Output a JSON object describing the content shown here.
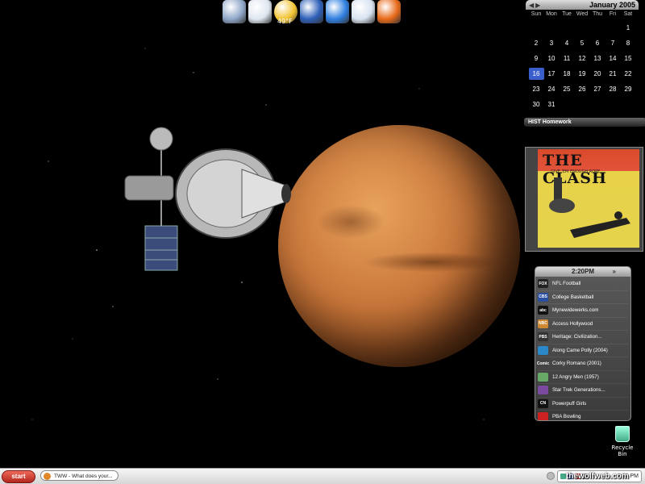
{
  "dock": {
    "items": [
      {
        "icon": "mail-icon",
        "color": "#8fa7c9"
      },
      {
        "icon": "clock-icon",
        "color": "#dfe6f0"
      },
      {
        "icon": "weather-icon",
        "color": "#f2c230",
        "label": "49°F"
      },
      {
        "icon": "app-launcher-icon",
        "color": "#2d5fb8"
      },
      {
        "icon": "gear-icon",
        "color": "#2f7fe0"
      },
      {
        "icon": "media-icon",
        "color": "#d8e3f0"
      },
      {
        "icon": "firefox-icon",
        "color": "#e86a1a"
      }
    ]
  },
  "calendar": {
    "month": "January 2005",
    "weekdays": [
      "Sun",
      "Mon",
      "Tue",
      "Wed",
      "Thu",
      "Fri",
      "Sat"
    ],
    "weeks": [
      [
        "",
        "",
        "",
        "",
        "",
        "",
        "1"
      ],
      [
        "2",
        "3",
        "4",
        "5",
        "6",
        "7",
        "8"
      ],
      [
        "9",
        "10",
        "11",
        "12",
        "13",
        "14",
        "15"
      ],
      [
        "16",
        "17",
        "18",
        "19",
        "20",
        "21",
        "22"
      ],
      [
        "23",
        "24",
        "25",
        "26",
        "27",
        "28",
        "29"
      ],
      [
        "30",
        "31",
        "",
        "",
        "",
        "",
        ""
      ]
    ],
    "today": "16",
    "today_color": "#3a5fcd"
  },
  "homework": {
    "label": "HIST Homework"
  },
  "album": {
    "title": "THE CLASH",
    "subtitle": "GIVE 'EM ENOUGH ROPE"
  },
  "tv_guide": {
    "time": "2:20PM",
    "arrow": "»",
    "listings": [
      {
        "channel": "FOX",
        "title": "NFL Football",
        "logo_color": "#222"
      },
      {
        "channel": "CBS",
        "title": "College Basketball",
        "logo_color": "#2a4fa0"
      },
      {
        "channel": "abc",
        "title": "Mynewidewerks.com",
        "logo_color": "#111"
      },
      {
        "channel": "NBC",
        "title": "Access Hollywood",
        "logo_color": "#c83"
      },
      {
        "channel": "PBS",
        "title": "Heritage: Civilization...",
        "logo_color": "#333"
      },
      {
        "channel": "",
        "title": "Along Came Polly (2004)",
        "logo_color": "#2a87c8"
      },
      {
        "channel": "Comic",
        "title": "Corky Romano (2001)",
        "logo_color": "#444"
      },
      {
        "channel": "",
        "title": "12 Angry Men (1957)",
        "logo_color": "#6a6"
      },
      {
        "channel": "",
        "title": "Star Trek Generations...",
        "logo_color": "#7a4aa0"
      },
      {
        "channel": "CN",
        "title": "Powerpuff Girls",
        "logo_color": "#111"
      },
      {
        "channel": "",
        "title": "PBA Bowling",
        "logo_color": "#c22"
      }
    ]
  },
  "recycle_bin": {
    "label": "Recycle Bin"
  },
  "taskbar": {
    "start_label": "start",
    "task_label": "TWW - What does your...",
    "clock": "2:29 PM"
  },
  "watermark": "thewolfweb.com"
}
